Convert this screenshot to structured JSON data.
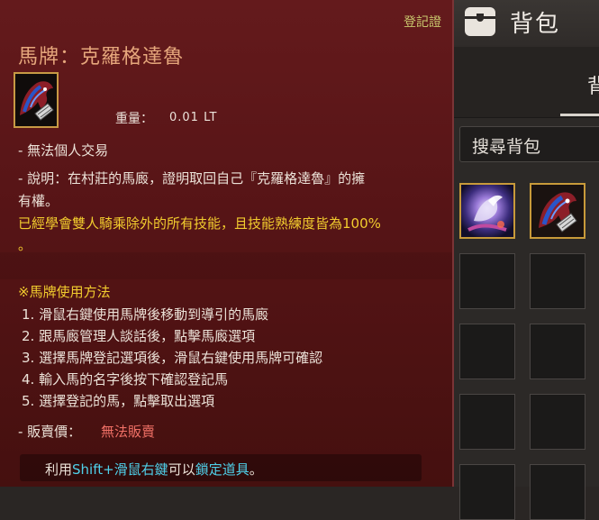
{
  "inventory": {
    "title": "背包",
    "partial_tab_label": "背",
    "search_placeholder": "搜尋背包",
    "slots": [
      {
        "icon": "magic-mount-icon",
        "filled": true
      },
      {
        "icon": "horse-medal-icon",
        "filled": true
      },
      {
        "icon": "",
        "filled": false
      },
      {
        "icon": "",
        "filled": false
      },
      {
        "icon": "",
        "filled": false
      },
      {
        "icon": "",
        "filled": false
      },
      {
        "icon": "",
        "filled": false
      },
      {
        "icon": "",
        "filled": false
      },
      {
        "icon": "",
        "filled": false
      },
      {
        "icon": "",
        "filled": false
      }
    ]
  },
  "tooltip": {
    "cert_tag": "登記證",
    "item_name": "馬牌：克羅格達魯",
    "item_icon": "horse-medal-icon",
    "weight_label": "重量：",
    "weight_value": "0.01 LT",
    "no_trade": "- 無法個人交易",
    "description_line1": "- 說明：在村莊的馬廄，證明取回自己『克羅格達魯』的擁",
    "description_line2": "有權。",
    "skill_note_line1": "已經學會雙人騎乘除外的所有技能，且技能熟練度皆為100%",
    "skill_note_line2": "。",
    "usage_title": "※馬牌使用方法",
    "usage_steps": [
      "1. 滑鼠右鍵使用馬牌後移動到導引的馬廄",
      "2. 跟馬廄管理人談話後，點擊馬廄選項",
      "3. 選擇馬牌登記選項後，滑鼠右鍵使用馬牌可確認",
      "4. 輸入馬的名字後按下確認登記馬",
      "5. 選擇登記的馬，點擊取出選項"
    ],
    "sell_price_label": "- 販賣價：",
    "sell_price_value": "無法販賣",
    "footer_prefix": "利用",
    "footer_keys": "Shift+滑鼠右鍵",
    "footer_middle": "可以",
    "footer_action": "鎖定道具",
    "footer_suffix": "。"
  },
  "colors": {
    "tooltip_bg": "#5a1517",
    "name_color": "#e6a77c",
    "yellow_text": "#f2cc2e",
    "red_text": "#f07066",
    "cyan_text": "#4fd0ea",
    "slot_border_gold": "#c89a3a"
  }
}
